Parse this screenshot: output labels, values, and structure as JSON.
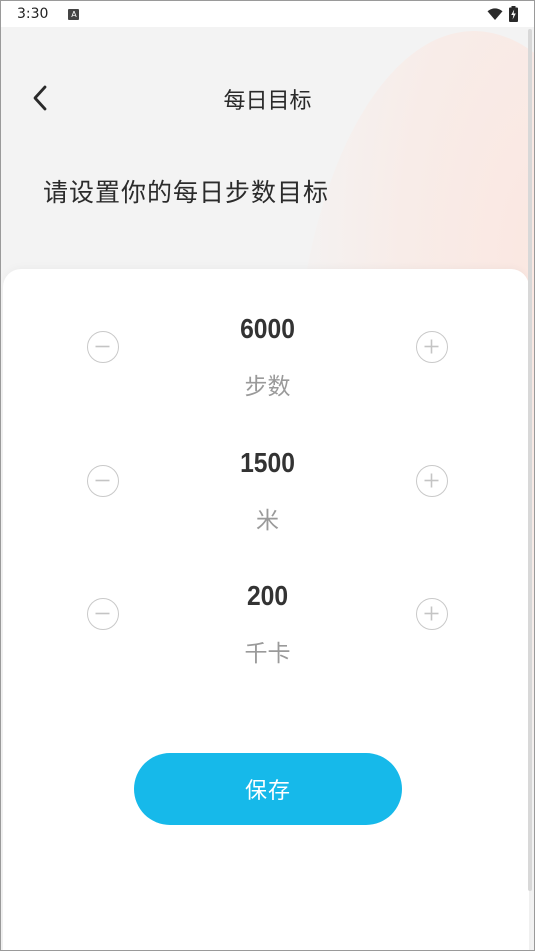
{
  "status_bar": {
    "time": "3:30",
    "notification_icon": "a-icon",
    "wifi_icon": "wifi-icon",
    "battery_icon": "battery-charging-icon"
  },
  "header": {
    "title": "每日目标",
    "back_icon": "chevron-left-icon"
  },
  "headline": "请设置你的每日步数目标",
  "goals": [
    {
      "value": "6000",
      "unit": "步数"
    },
    {
      "value": "1500",
      "unit": "米"
    },
    {
      "value": "200",
      "unit": "千卡"
    }
  ],
  "save_label": "保存",
  "colors": {
    "accent": "#16b9ea",
    "title_text": "#2a2a2a",
    "unit_text": "#9a9a9a"
  }
}
